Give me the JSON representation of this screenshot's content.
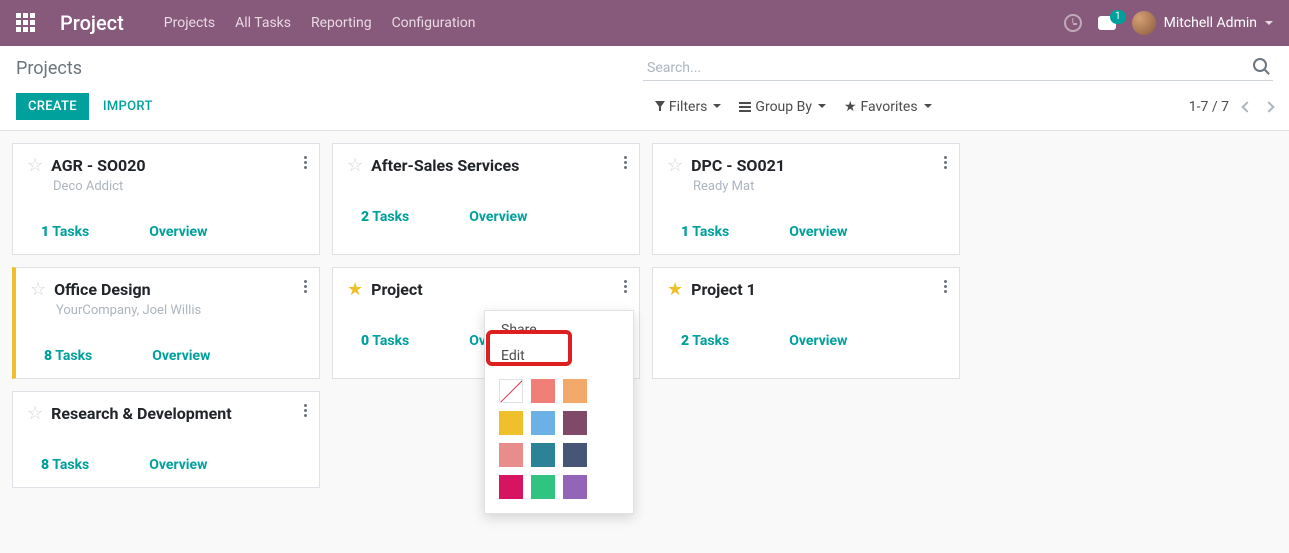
{
  "header": {
    "brand": "Project",
    "nav": [
      "Projects",
      "All Tasks",
      "Reporting",
      "Configuration"
    ],
    "chat_badge": "1",
    "user_name": "Mitchell Admin"
  },
  "controlbar": {
    "page_title": "Projects",
    "search_placeholder": "Search...",
    "create_label": "CREATE",
    "import_label": "IMPORT",
    "filters_label": "Filters",
    "groupby_label": "Group By",
    "favorites_label": "Favorites",
    "pager_text": "1-7 / 7"
  },
  "cards": [
    {
      "title": "AGR - SO020",
      "subtitle": "Deco Addict",
      "tasks_count": "1",
      "tasks_label": "Tasks",
      "overview_label": "Overview",
      "favorite": false,
      "yellow_edge": false
    },
    {
      "title": "After-Sales Services",
      "subtitle": "",
      "tasks_count": "2",
      "tasks_label": "Tasks",
      "overview_label": "Overview",
      "favorite": false,
      "yellow_edge": false
    },
    {
      "title": "DPC - SO021",
      "subtitle": "Ready Mat",
      "tasks_count": "1",
      "tasks_label": "Tasks",
      "overview_label": "Overview",
      "favorite": false,
      "yellow_edge": false
    },
    {
      "title": "Office Design",
      "subtitle": "YourCompany, Joel Willis",
      "tasks_count": "8",
      "tasks_label": "Tasks",
      "overview_label": "Overview",
      "favorite": false,
      "yellow_edge": true
    },
    {
      "title": "Project",
      "subtitle": "",
      "tasks_count": "0",
      "tasks_label": "Tasks",
      "overview_label": "Overview",
      "favorite": true,
      "yellow_edge": false
    },
    {
      "title": "Project 1",
      "subtitle": "",
      "tasks_count": "2",
      "tasks_label": "Tasks",
      "overview_label": "Overview",
      "favorite": true,
      "yellow_edge": false
    },
    {
      "title": "Research & Development",
      "subtitle": "",
      "tasks_count": "8",
      "tasks_label": "Tasks",
      "overview_label": "Overview",
      "favorite": false,
      "yellow_edge": false
    }
  ],
  "dropdown": {
    "share_label": "Share",
    "edit_label": "Edit",
    "colors": [
      "none",
      "#ef7f77",
      "#f2a96b",
      "#f0c02c",
      "#6bb1e6",
      "#814968",
      "#e88c8c",
      "#2c8397",
      "#475577",
      "#d6145f",
      "#30c381",
      "#9365b8"
    ]
  }
}
